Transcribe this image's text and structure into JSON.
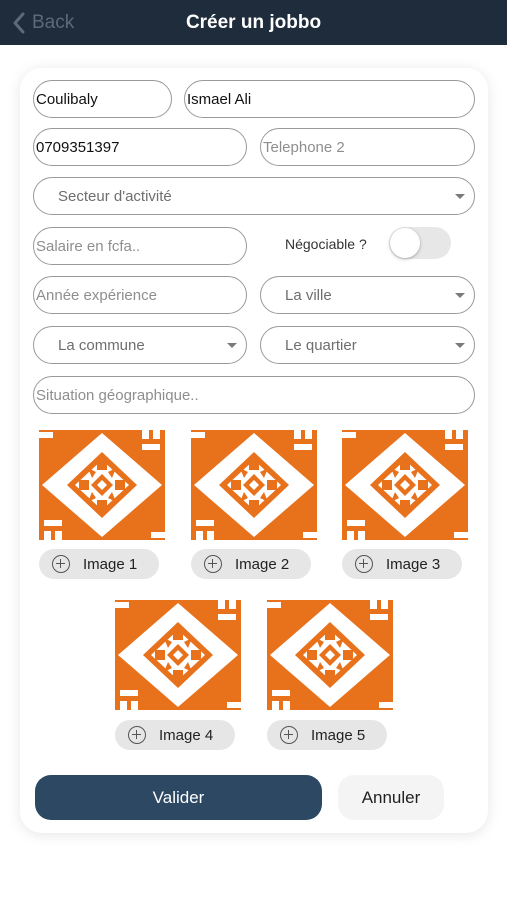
{
  "header": {
    "back_label": "Back",
    "title": "Créer un jobbo"
  },
  "form": {
    "nom": {
      "value": "Coulibaly",
      "placeholder": ""
    },
    "prenoms": {
      "value": "Ismael Ali",
      "placeholder": ""
    },
    "telephone1": {
      "value": "0709351397",
      "placeholder": ""
    },
    "telephone2": {
      "value": "",
      "placeholder": "Telephone 2"
    },
    "secteur": {
      "label": "Secteur d'activité"
    },
    "salaire": {
      "value": "",
      "placeholder": "Salaire en fcfa.."
    },
    "negociable": {
      "label": "Négociable ?",
      "checked": false
    },
    "experience": {
      "value": "",
      "placeholder": "Année expérience"
    },
    "ville": {
      "label": "La ville"
    },
    "commune": {
      "label": "La commune"
    },
    "quartier": {
      "label": "Le quartier"
    },
    "situation": {
      "value": "",
      "placeholder": "Situation géographique.."
    }
  },
  "images": [
    {
      "label": "Image 1"
    },
    {
      "label": "Image 2"
    },
    {
      "label": "Image 3"
    },
    {
      "label": "Image 4"
    },
    {
      "label": "Image 5"
    }
  ],
  "actions": {
    "valider": "Valider",
    "annuler": "Annuler"
  },
  "colors": {
    "header_bg": "#1e2c3b",
    "primary_button": "#2c4863",
    "placeholder_tile": "#e8711c"
  },
  "icons": {
    "back": "chevron-left-icon",
    "add_image": "plus-circle-icon",
    "dropdown": "caret-down-icon",
    "image_placeholder": "orange-tile-pattern-icon"
  }
}
